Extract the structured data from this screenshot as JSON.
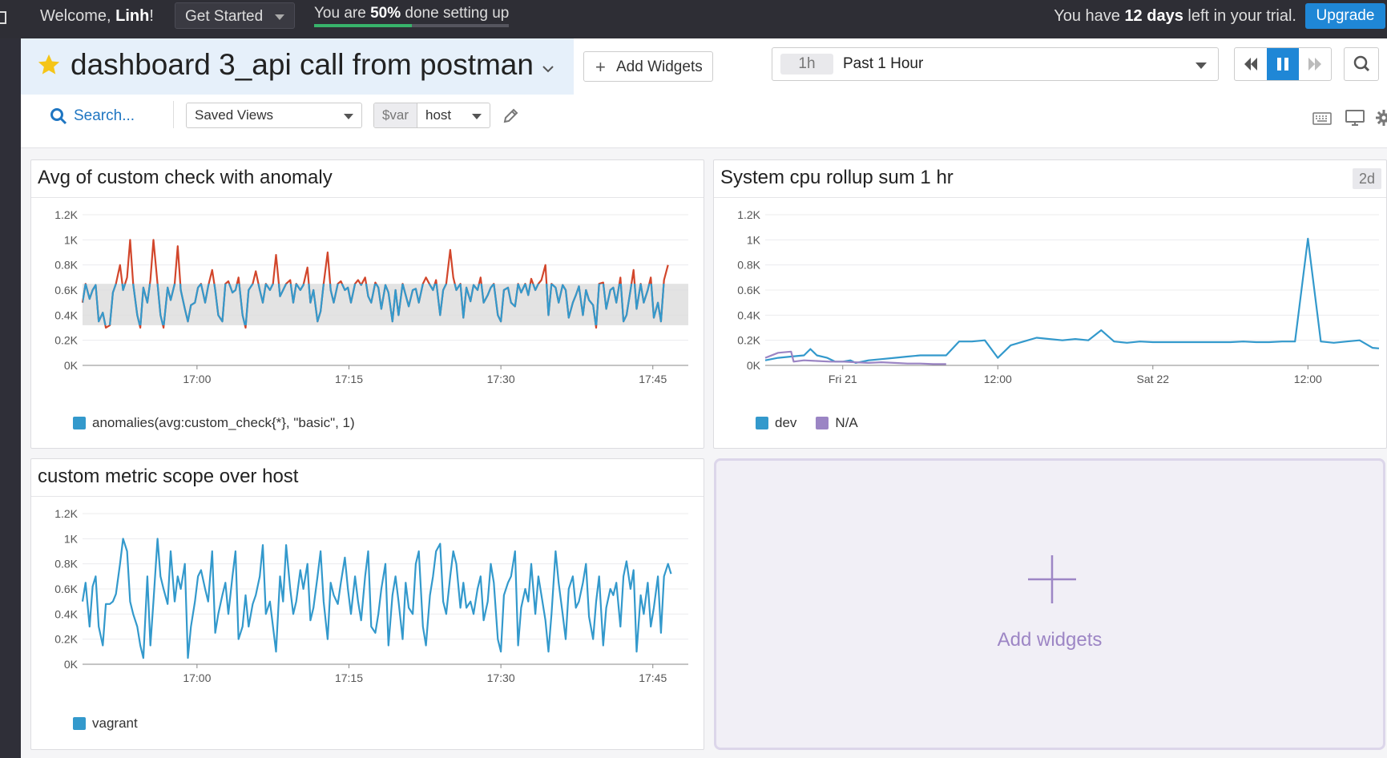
{
  "topbar": {
    "welcome_prefix": "Welcome, ",
    "user_name": "Linh",
    "welcome_suffix": "!",
    "get_started_label": "Get Started",
    "progress_prefix": "You are ",
    "progress_percent": "50%",
    "progress_suffix": " done setting up",
    "progress_fraction": 0.5,
    "trial_prefix": "You have ",
    "trial_days": "12 days",
    "trial_suffix": " left in your trial.",
    "upgrade_label": "Upgrade"
  },
  "header": {
    "title": "dashboard 3_api call from postman",
    "add_widgets_label": "Add Widgets",
    "time_badge": "1h",
    "time_label": "Past 1 Hour",
    "search_label": "Search...",
    "saved_views_label": "Saved Views",
    "var_prefix": "$var",
    "var_value": "host"
  },
  "colors": {
    "accent_blue": "#1f87d6",
    "series_blue": "#3399cc",
    "series_red": "#d2462b",
    "series_purple": "#9b85c4",
    "band_gray": "#dcdcdc",
    "progress_green": "#38b36b"
  },
  "widgets": [
    {
      "title": "Avg of custom check with anomaly",
      "legend": [
        {
          "label": "anomalies(avg:custom_check{*}, \"basic\", 1)",
          "color": "#3399cc"
        }
      ]
    },
    {
      "title": "System cpu rollup sum 1 hr",
      "badge": "2d",
      "legend": [
        {
          "label": "dev",
          "color": "#3399cc"
        },
        {
          "label": "N/A",
          "color": "#9b85c4"
        }
      ]
    },
    {
      "title": "custom metric scope over host",
      "legend": [
        {
          "label": "vagrant",
          "color": "#3399cc"
        }
      ]
    },
    {
      "add_label": "Add widgets"
    }
  ],
  "chart_data": [
    {
      "type": "line",
      "title": "Avg of custom check with anomaly",
      "xlabel": "",
      "ylabel": "",
      "ylim": [
        0,
        1200
      ],
      "y_ticks": [
        "0K",
        "0.2K",
        "0.4K",
        "0.6K",
        "0.8K",
        "1K",
        "1.2K"
      ],
      "x_ticks": [
        "17:00",
        "17:15",
        "17:30",
        "17:45"
      ],
      "x_tick_minutes": [
        0,
        15,
        30,
        45
      ],
      "x_range_minutes": [
        -11.3,
        48.5
      ],
      "band": {
        "lower": 320,
        "upper": 650
      },
      "series": [
        {
          "name": "anomalies(avg:custom_check{*}, \"basic\", 1)",
          "x_minutes": [
            -11.3,
            -11.0,
            -10.6,
            -10.3,
            -10.0,
            -9.7,
            -9.3,
            -9.0,
            -8.6,
            -8.3,
            -8.0,
            -7.6,
            -7.3,
            -6.9,
            -6.6,
            -6.3,
            -5.9,
            -5.6,
            -5.3,
            -4.9,
            -4.6,
            -4.3,
            -3.9,
            -3.6,
            -3.3,
            -2.9,
            -2.6,
            -2.2,
            -1.9,
            -1.6,
            -1.2,
            -0.9,
            -0.6,
            -0.2,
            0.1,
            0.4,
            0.8,
            1.1,
            1.5,
            1.8,
            2.1,
            2.5,
            2.8,
            3.1,
            3.5,
            3.8,
            4.1,
            4.5,
            4.8,
            5.1,
            5.5,
            5.8,
            6.2,
            6.5,
            6.8,
            7.2,
            7.5,
            7.8,
            8.2,
            8.5,
            8.8,
            9.2,
            9.5,
            9.8,
            10.2,
            10.5,
            10.9,
            11.2,
            11.5,
            11.9,
            12.2,
            12.5,
            12.9,
            13.2,
            13.5,
            13.9,
            14.2,
            14.6,
            14.9,
            15.2,
            15.6,
            15.9,
            16.2,
            16.6,
            16.9,
            17.2,
            17.6,
            17.9,
            18.2,
            18.6,
            18.9,
            19.3,
            19.6,
            19.9,
            20.3,
            20.6,
            20.9,
            21.3,
            21.6,
            21.9,
            22.3,
            22.6,
            23.0,
            23.3,
            23.6,
            24.0,
            24.3,
            24.6,
            25.0,
            25.3,
            25.6,
            26.0,
            26.3,
            26.6,
            27.0,
            27.3,
            27.7,
            28.0,
            28.3,
            28.7,
            29.0,
            29.3,
            29.7,
            30.0,
            30.3,
            30.7,
            31.0,
            31.4,
            31.7,
            32.0,
            32.4,
            32.7,
            33.0,
            33.4,
            33.7,
            34.0,
            34.4,
            34.7,
            35.0,
            35.4,
            35.7,
            36.1,
            36.4,
            36.7,
            37.1,
            37.4,
            37.7,
            38.1,
            38.4,
            38.7,
            39.1,
            39.4,
            39.7,
            40.1,
            40.4,
            40.8,
            41.1,
            41.4,
            41.8,
            42.1,
            42.4,
            42.8,
            43.1,
            43.4,
            43.8,
            44.1,
            44.5,
            44.8,
            45.1,
            45.5,
            45.8,
            46.1,
            46.5,
            46.8,
            47.1,
            47.5,
            47.8,
            48.1,
            48.5
          ],
          "y": [
            500,
            650,
            530,
            600,
            640,
            350,
            420,
            300,
            320,
            580,
            650,
            800,
            600,
            700,
            1000,
            650,
            400,
            300,
            620,
            500,
            680,
            1000,
            650,
            400,
            300,
            620,
            520,
            650,
            950,
            600,
            450,
            350,
            480,
            500,
            620,
            650,
            500,
            630,
            760,
            600,
            400,
            350,
            650,
            670,
            580,
            600,
            700,
            400,
            300,
            600,
            650,
            750,
            600,
            500,
            650,
            600,
            650,
            880,
            550,
            600,
            650,
            680,
            500,
            650,
            600,
            640,
            780,
            500,
            600,
            350,
            430,
            650,
            900,
            600,
            500,
            650,
            670,
            600,
            620,
            500,
            650,
            680,
            640,
            700,
            550,
            500,
            660,
            620,
            450,
            640,
            580,
            350,
            600,
            400,
            650,
            560,
            470,
            600,
            610,
            500,
            650,
            700,
            640,
            600,
            680,
            400,
            600,
            650,
            920,
            700,
            600,
            650,
            380,
            620,
            510,
            640,
            600,
            700,
            500,
            560,
            620,
            650,
            400,
            350,
            600,
            620,
            500,
            470,
            650,
            580,
            650,
            560,
            690,
            600,
            650,
            680,
            800,
            400,
            650,
            620,
            500,
            640,
            600,
            380,
            500,
            560,
            630,
            400,
            600,
            520,
            480,
            300,
            650,
            660,
            450,
            600,
            620,
            500,
            700,
            350,
            400,
            600,
            760,
            450,
            650,
            500,
            600,
            700,
            380,
            500,
            350,
            680,
            800
          ]
        }
      ]
    },
    {
      "type": "line",
      "title": "System cpu rollup sum 1 hr",
      "xlabel": "",
      "ylabel": "",
      "ylim": [
        0,
        1200
      ],
      "y_ticks": [
        "0K",
        "0.2K",
        "0.4K",
        "0.6K",
        "0.8K",
        "1K",
        "1.2K"
      ],
      "x_ticks": [
        "Fri 21",
        "12:00",
        "Sat 22",
        "12:00"
      ],
      "x_tick_hours": [
        0,
        12,
        24,
        36
      ],
      "x_range_hours": [
        -6,
        41.5
      ],
      "series": [
        {
          "name": "dev",
          "x_hours": [
            -6,
            -5,
            -4,
            -3,
            -2.5,
            -2,
            -1.2,
            -0.6,
            0,
            0.6,
            1,
            2,
            3,
            4,
            5,
            6,
            7,
            8,
            9,
            10,
            11,
            12,
            13,
            14,
            15,
            16,
            17,
            18,
            19,
            20,
            21,
            22,
            23,
            24,
            25,
            26,
            27,
            28,
            29,
            30,
            31,
            32,
            33,
            34,
            35,
            36,
            37,
            38,
            39,
            40,
            41,
            41.5
          ],
          "y": [
            40,
            60,
            70,
            80,
            130,
            80,
            60,
            30,
            30,
            40,
            20,
            40,
            50,
            60,
            70,
            80,
            80,
            80,
            190,
            190,
            200,
            60,
            160,
            190,
            220,
            210,
            200,
            210,
            200,
            280,
            190,
            180,
            190,
            185,
            185,
            185,
            185,
            185,
            185,
            185,
            190,
            185,
            185,
            190,
            190,
            1010,
            190,
            180,
            190,
            200,
            140,
            135
          ]
        },
        {
          "name": "N/A",
          "x_hours": [
            -6,
            -5,
            -4,
            -3.8,
            -3,
            -2,
            -1,
            0,
            1,
            2,
            3,
            4,
            5,
            6,
            7,
            8
          ],
          "y": [
            60,
            100,
            110,
            30,
            40,
            35,
            30,
            30,
            25,
            20,
            25,
            20,
            15,
            15,
            10,
            10
          ]
        }
      ]
    },
    {
      "type": "line",
      "title": "custom metric scope over host",
      "xlabel": "",
      "ylabel": "",
      "ylim": [
        0,
        1200
      ],
      "y_ticks": [
        "0K",
        "0.2K",
        "0.4K",
        "0.6K",
        "0.8K",
        "1K",
        "1.2K"
      ],
      "x_ticks": [
        "17:00",
        "17:15",
        "17:30",
        "17:45"
      ],
      "x_tick_minutes": [
        0,
        15,
        30,
        45
      ],
      "x_range_minutes": [
        -11.3,
        48.5
      ],
      "series": [
        {
          "name": "vagrant",
          "x_minutes": [
            -11.3,
            -11.0,
            -10.6,
            -10.3,
            -10.0,
            -9.7,
            -9.3,
            -9.0,
            -8.6,
            -8.3,
            -8.0,
            -7.6,
            -7.3,
            -6.9,
            -6.6,
            -6.3,
            -5.9,
            -5.6,
            -5.3,
            -4.9,
            -4.6,
            -4.3,
            -3.9,
            -3.6,
            -3.3,
            -2.9,
            -2.6,
            -2.2,
            -1.9,
            -1.6,
            -1.2,
            -0.9,
            -0.6,
            -0.2,
            0.1,
            0.4,
            0.8,
            1.1,
            1.5,
            1.8,
            2.1,
            2.5,
            2.8,
            3.1,
            3.5,
            3.8,
            4.1,
            4.5,
            4.8,
            5.1,
            5.5,
            5.8,
            6.2,
            6.5,
            6.8,
            7.2,
            7.5,
            7.8,
            8.2,
            8.5,
            8.8,
            9.2,
            9.5,
            9.8,
            10.2,
            10.5,
            10.9,
            11.2,
            11.5,
            11.9,
            12.2,
            12.5,
            12.9,
            13.2,
            13.5,
            13.9,
            14.2,
            14.6,
            14.9,
            15.2,
            15.6,
            15.9,
            16.2,
            16.6,
            16.9,
            17.2,
            17.6,
            17.9,
            18.2,
            18.6,
            18.9,
            19.3,
            19.6,
            19.9,
            20.3,
            20.6,
            20.9,
            21.3,
            21.6,
            21.9,
            22.3,
            22.6,
            23.0,
            23.3,
            23.6,
            24.0,
            24.3,
            24.6,
            25.0,
            25.3,
            25.6,
            26.0,
            26.3,
            26.6,
            27.0,
            27.3,
            27.7,
            28.0,
            28.3,
            28.7,
            29.0,
            29.3,
            29.7,
            30.0,
            30.3,
            30.7,
            31.0,
            31.4,
            31.7,
            32.0,
            32.4,
            32.7,
            33.0,
            33.4,
            33.7,
            34.0,
            34.4,
            34.7,
            35.0,
            35.4,
            35.7,
            36.1,
            36.4,
            36.7,
            37.1,
            37.4,
            37.7,
            38.1,
            38.4,
            38.7,
            39.1,
            39.4,
            39.7,
            40.1,
            40.4,
            40.8,
            41.1,
            41.4,
            41.8,
            42.1,
            42.4,
            42.8,
            43.1,
            43.4,
            43.8,
            44.1,
            44.5,
            44.8,
            45.1,
            45.5,
            45.8,
            46.1,
            46.5,
            46.8,
            47.1,
            47.5,
            47.8,
            48.1,
            48.5
          ],
          "y": [
            500,
            650,
            300,
            620,
            700,
            300,
            150,
            480,
            480,
            500,
            560,
            800,
            1000,
            900,
            500,
            400,
            300,
            150,
            50,
            700,
            150,
            500,
            1000,
            700,
            600,
            480,
            900,
            500,
            700,
            600,
            800,
            50,
            300,
            500,
            700,
            750,
            600,
            500,
            900,
            250,
            400,
            550,
            650,
            400,
            700,
            900,
            200,
            300,
            550,
            300,
            480,
            550,
            700,
            950,
            400,
            500,
            300,
            100,
            700,
            500,
            950,
            600,
            400,
            500,
            750,
            600,
            800,
            350,
            450,
            700,
            900,
            500,
            200,
            650,
            550,
            480,
            650,
            850,
            600,
            400,
            700,
            500,
            350,
            700,
            900,
            300,
            250,
            400,
            600,
            800,
            150,
            550,
            700,
            500,
            200,
            650,
            450,
            400,
            800,
            900,
            300,
            150,
            550,
            700,
            900,
            960,
            500,
            400,
            700,
            900,
            800,
            450,
            650,
            450,
            500,
            400,
            600,
            700,
            350,
            500,
            800,
            650,
            200,
            100,
            550,
            650,
            700,
            900,
            150,
            450,
            600,
            500,
            800,
            400,
            700,
            550,
            350,
            100,
            400,
            900,
            650,
            400,
            200,
            600,
            700,
            450,
            500,
            650,
            800,
            380,
            200,
            500,
            700,
            150,
            450,
            600,
            550,
            650,
            300,
            700,
            820,
            600,
            750,
            100,
            550,
            400,
            650,
            300,
            450,
            700,
            250,
            700,
            800,
            720
          ]
        }
      ]
    }
  ]
}
